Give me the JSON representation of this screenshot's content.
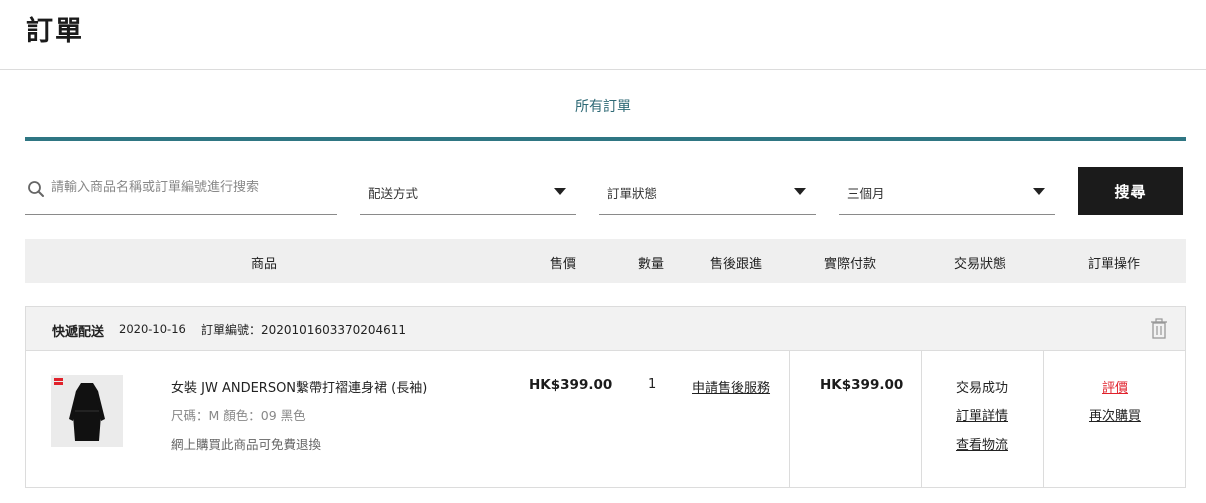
{
  "page": {
    "title": "訂單"
  },
  "tabs": {
    "all_orders": "所有訂單"
  },
  "filters": {
    "search_placeholder": "請輸入商品名稱或訂單編號進行搜索",
    "delivery": "配送方式",
    "status": "訂單狀態",
    "period": "三個月",
    "search_button": "搜尋"
  },
  "table_headers": {
    "product": "商品",
    "price": "售價",
    "quantity": "數量",
    "after_sales": "售後跟進",
    "actual_paid": "實際付款",
    "trade_status": "交易狀態",
    "operation": "訂單操作"
  },
  "orders": [
    {
      "delivery_method": "快遞配送",
      "date": "2020-10-16",
      "order_no": "訂單編號：202010160337020461​1",
      "product": {
        "name": "女裝 JW ANDERSON繫帶打褶連身裙 (長袖)",
        "spec": "尺碼：M  顏色：09 黑色",
        "return_note": "網上購買此商品可免費退換"
      },
      "price": "HK$399.00",
      "quantity": "1",
      "after_sales_link": "申請售後服務",
      "actual_paid": "HK$399.00",
      "status": {
        "text": "交易成功",
        "detail_link": "訂單詳情",
        "logistics_link": "查看物流"
      },
      "actions": {
        "review": "評價",
        "rebuy": "再次購買"
      }
    }
  ],
  "colors": {
    "accent_teal": "#2f7683",
    "review_red": "#e0212b",
    "button_black": "#1b1b1b"
  }
}
